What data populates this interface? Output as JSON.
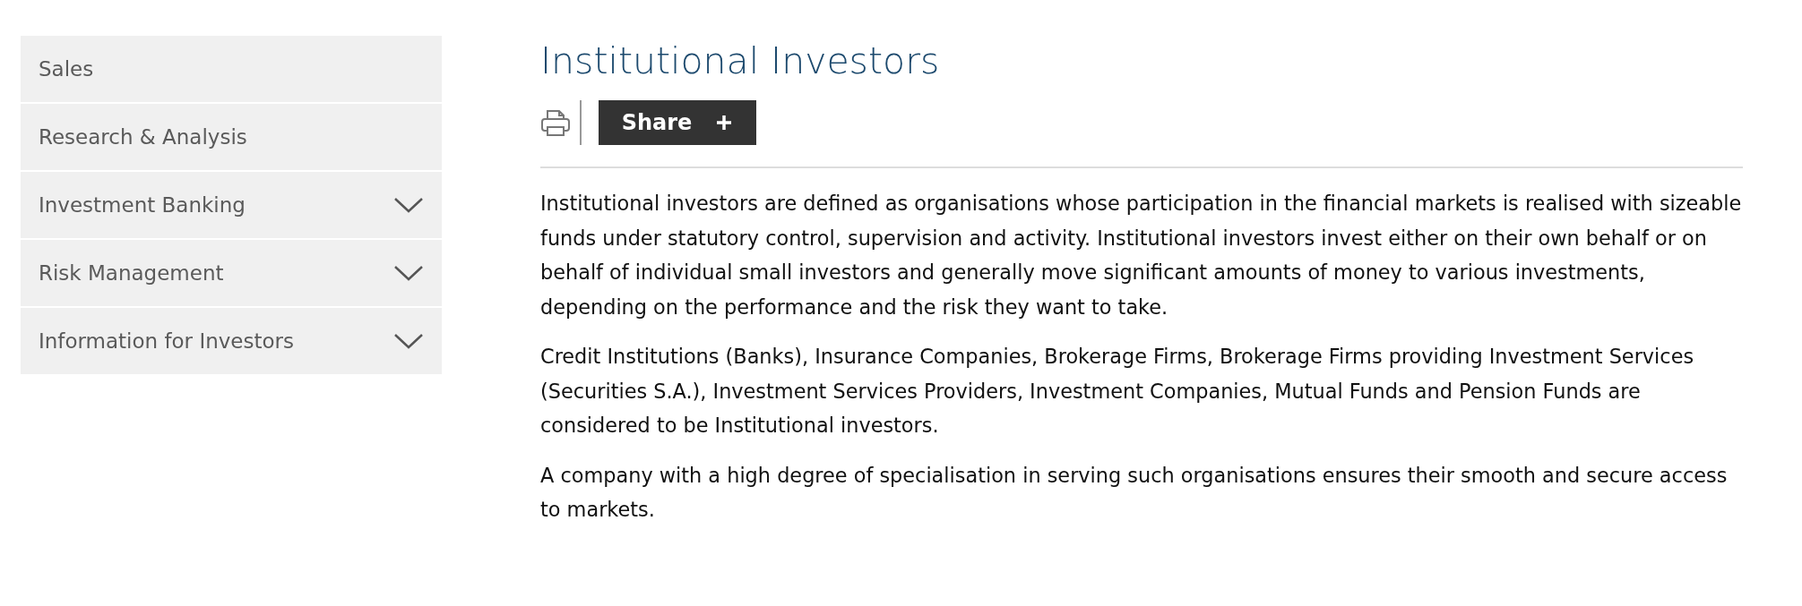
{
  "sidebar": {
    "items": [
      {
        "label": "Sales",
        "expandable": false
      },
      {
        "label": "Research & Analysis",
        "expandable": false
      },
      {
        "label": "Investment Banking",
        "expandable": true
      },
      {
        "label": "Risk Management",
        "expandable": true
      },
      {
        "label": "Information for Investors",
        "expandable": true
      }
    ]
  },
  "article": {
    "title": "Institutional Investors",
    "share_button": "Share",
    "paragraphs": [
      "Institutional investors are defined as organisations whose participation in the financial markets is realised with sizeable funds under statutory control, supervision and activity. Institutional investors invest either on their own behalf or on behalf of individual small investors and generally move significant amounts of money to various investments, depending on the performance and the risk they want to take.",
      "Credit Institutions (Banks), Insurance Companies, Brokerage Firms, Brokerage Firms providing Investment Services (Securities S.A.), Investment Services Providers, Investment Companies, Mutual Funds and Pension Funds are considered to be Institutional investors.",
      "A company with a high degree of specialisation in serving such organisations ensures their smooth and secure access to markets."
    ]
  }
}
